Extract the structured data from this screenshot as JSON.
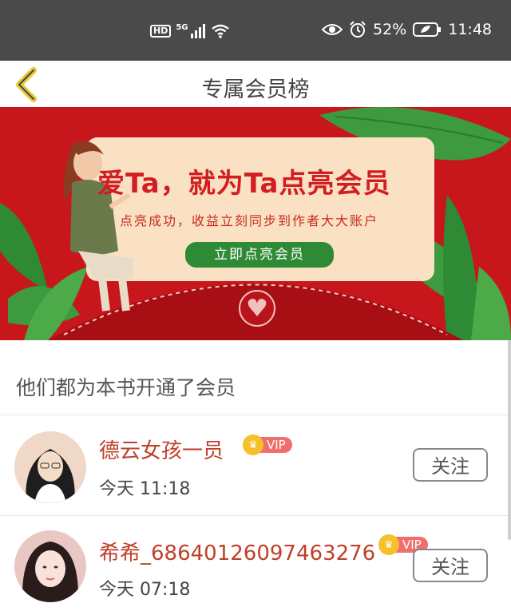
{
  "status_bar": {
    "network_hd": "HD",
    "network_5g": "5G",
    "battery": "52%",
    "time": "11:48"
  },
  "navbar": {
    "title": "专属会员榜"
  },
  "banner": {
    "headline": "爱Ta，就为Ta点亮会员",
    "subtitle": "点亮成功，收益立刻同步到作者大大账户",
    "button_label": "立即点亮会员"
  },
  "section": {
    "heading": "他们都为本书开通了会员"
  },
  "members": [
    {
      "name": "德云女孩一员",
      "badge": "VIP",
      "time": "今天 11:18",
      "follow_label": "关注"
    },
    {
      "name": "希希_68640126097463276",
      "badge": "VIP",
      "time": "今天 07:18",
      "follow_label": "关注"
    }
  ],
  "colors": {
    "banner_red": "#c8161d",
    "name_red": "#c0402a",
    "button_green": "#2e8a35"
  }
}
